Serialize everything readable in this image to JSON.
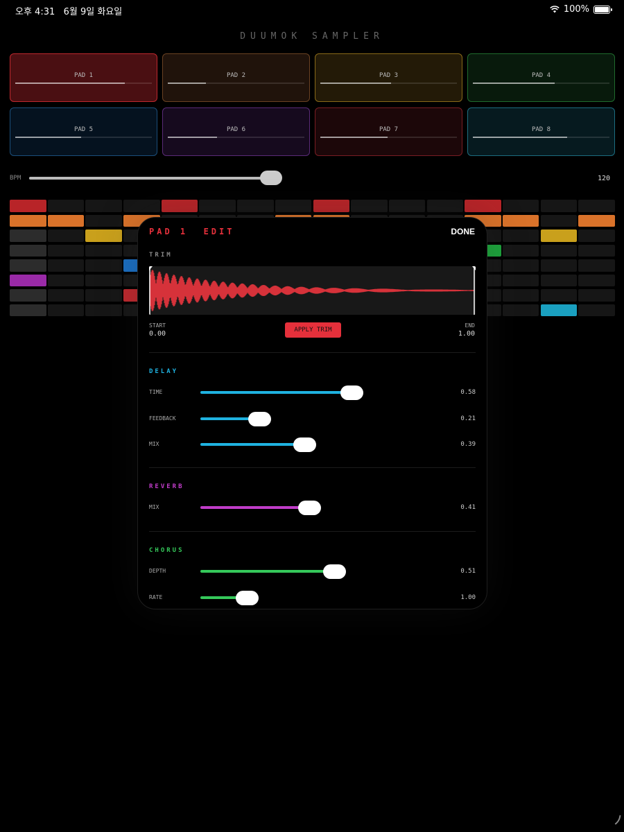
{
  "status": {
    "time": "오후 4:31",
    "date": "6월 9일 화요일",
    "battery": "100%"
  },
  "app_title": "DUUMOK SAMPLER",
  "pads": [
    {
      "label": "PAD 1",
      "level": 0.8,
      "bg": "#4a0f12",
      "border": "#c0282e"
    },
    {
      "label": "PAD 2",
      "level": 0.28,
      "bg": "#20130b",
      "border": "#6b4222"
    },
    {
      "label": "PAD 3",
      "level": 0.52,
      "bg": "#231a07",
      "border": "#8a6a18"
    },
    {
      "label": "PAD 4",
      "level": 0.6,
      "bg": "#081a0c",
      "border": "#1f6b2d"
    },
    {
      "label": "PAD 5",
      "level": 0.48,
      "bg": "#05121f",
      "border": "#1b4f7c"
    },
    {
      "label": "PAD 6",
      "level": 0.36,
      "bg": "#160a1e",
      "border": "#5a2a78"
    },
    {
      "label": "PAD 7",
      "level": 0.49,
      "bg": "#1c0709",
      "border": "#7a1d23"
    },
    {
      "label": "PAD 8",
      "level": 0.69,
      "bg": "#061a1f",
      "border": "#1c6d80"
    }
  ],
  "bpm": {
    "label": "BPM",
    "value": "120",
    "level": 0.97
  },
  "sequencer": {
    "row_colors": [
      "#b82428",
      "#d9722a",
      "#c9a01c",
      "#1da53c",
      "#1a6fc4",
      "#9a2aa8",
      "#c0282e",
      "#1aa0c0"
    ],
    "rows": [
      [
        0,
        4,
        8,
        12
      ],
      [
        0,
        1,
        3,
        7,
        8,
        12,
        13,
        15
      ],
      [
        2,
        14
      ],
      [
        12
      ],
      [
        3
      ],
      [
        0
      ],
      [
        3
      ],
      [
        14
      ]
    ]
  },
  "edit": {
    "title": "PAD 1  EDIT",
    "done": "DONE",
    "trim": {
      "title": "TRIM",
      "start_label": "START",
      "start_value": "0.00",
      "end_label": "END",
      "end_value": "1.00",
      "apply": "APPLY TRIM"
    },
    "delay": {
      "title": "DELAY",
      "color": "#1fb2e0",
      "sliders": [
        {
          "label": "TIME",
          "value": "0.58",
          "level": 0.58
        },
        {
          "label": "FEEDBACK",
          "value": "0.21",
          "level": 0.21
        },
        {
          "label": "MIX",
          "value": "0.39",
          "level": 0.39
        }
      ]
    },
    "reverb": {
      "title": "REVERB",
      "color": "#c03cc8",
      "sliders": [
        {
          "label": "MIX",
          "value": "0.41",
          "level": 0.41
        }
      ]
    },
    "chorus": {
      "title": "CHORUS",
      "color": "#35c85a",
      "sliders": [
        {
          "label": "DEPTH",
          "value": "0.51",
          "level": 0.51
        },
        {
          "label": "RATE",
          "value": "1.00",
          "level": 0.16
        }
      ]
    }
  }
}
